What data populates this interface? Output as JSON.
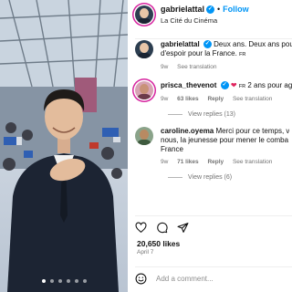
{
  "post": {
    "username": "gabrielattal",
    "follow_label": "Follow",
    "separator": "•",
    "location": "La Cité du Cinéma",
    "caption": {
      "username": "gabrielattal",
      "text_line1": "Deux ans. Deux ans pour",
      "text_line2": "d'espoir pour la France.",
      "lang_tag": "FR",
      "time": "9w",
      "see_translation": "See translation"
    },
    "comments": [
      {
        "username": "prisca_thevenot",
        "emoji": "❤",
        "lang_tag": "FR",
        "text": "2 ans pour ag",
        "time": "9w",
        "likes": "63 likes",
        "reply": "Reply",
        "see_translation": "See translation",
        "view_replies": "View replies (13)"
      },
      {
        "username": "caroline.oyema",
        "text_line1": "Merci pour ce temps, v",
        "text_line2": "nous, la jeunesse pour mener le comba",
        "text_line3": "France",
        "time": "9w",
        "likes": "71 likes",
        "reply": "Reply",
        "see_translation": "See translation",
        "view_replies": "View replies (6)"
      }
    ],
    "likes_count": "20,650 likes",
    "date": "April 7",
    "add_comment_placeholder": "Add a comment...",
    "carousel": {
      "count": 6,
      "active_index": 0
    },
    "accent_color": "#0095f6",
    "icons": [
      "heart-icon",
      "comment-icon",
      "share-icon",
      "emoji-icon",
      "verified-icon"
    ]
  }
}
